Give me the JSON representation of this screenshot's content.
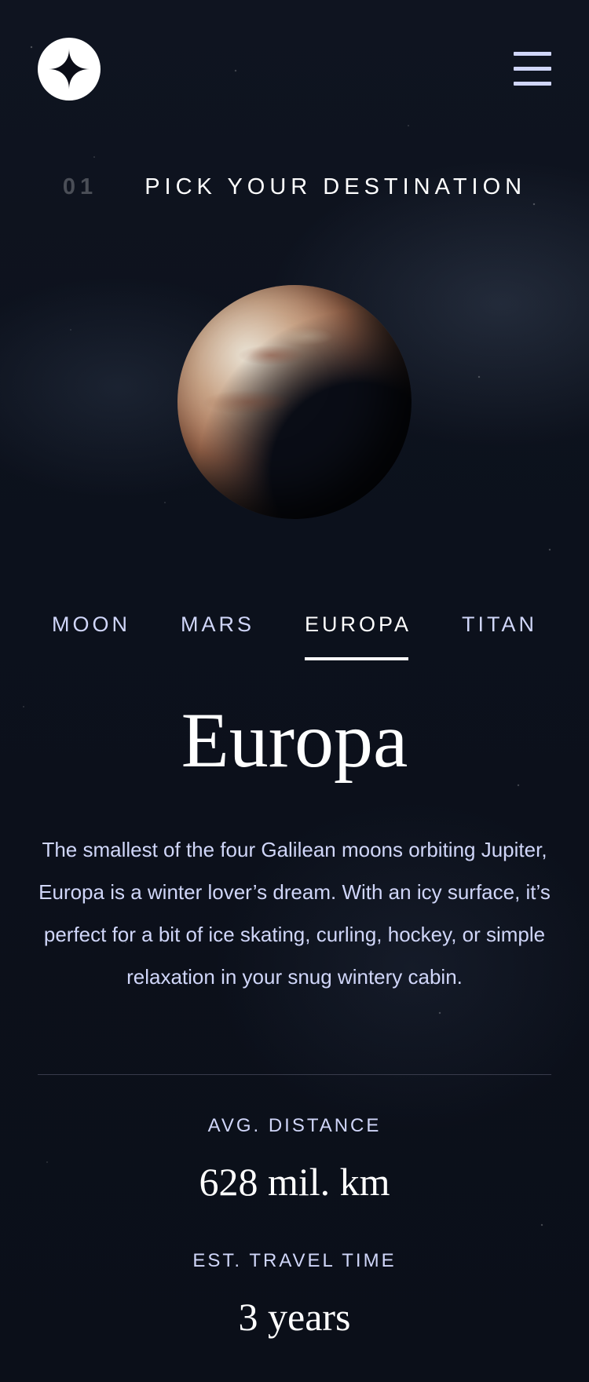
{
  "header": {
    "logo_icon": "four-point-star-icon",
    "menu_icon": "hamburger-menu-icon"
  },
  "section": {
    "number": "01",
    "title": "PICK YOUR DESTINATION"
  },
  "tabs": [
    {
      "label": "MOON",
      "active": false
    },
    {
      "label": "MARS",
      "active": false
    },
    {
      "label": "EUROPA",
      "active": true
    },
    {
      "label": "TITAN",
      "active": false
    }
  ],
  "destination": {
    "name": "Europa",
    "description": "The smallest of the four Galilean moons orbiting Jupiter, Europa is a winter lover’s dream. With an icy surface, it’s perfect for a bit of ice skating, curling, hockey, or simple relaxation in your snug wintery cabin.",
    "stats": {
      "distance_label": "AVG. DISTANCE",
      "distance_value": "628 mil. km",
      "travel_label": "EST. TRAVEL TIME",
      "travel_value": "3 years"
    }
  },
  "colors": {
    "background": "#0b0d17",
    "accent_text": "#d0d6f9",
    "white": "#ffffff"
  }
}
